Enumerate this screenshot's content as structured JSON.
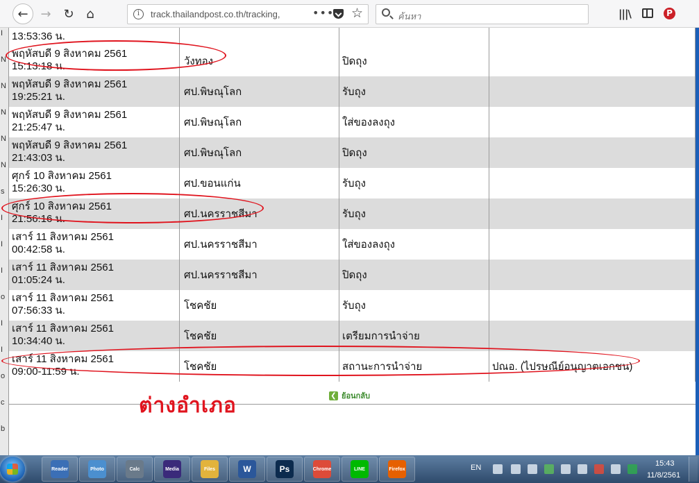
{
  "browser": {
    "url": "track.thailandpost.co.th/tracking,",
    "search_placeholder": "ค้นหา",
    "overflow_dots": "•••"
  },
  "table": {
    "top_cut_time": "13:53:36 น.",
    "rows": [
      {
        "date": "พฤหัสบดี 9 สิงหาคม 2561",
        "time": "15:13:18 น.",
        "location": "วังทอง",
        "status": "ปิดถุง",
        "note": ""
      },
      {
        "date": "พฤหัสบดี 9 สิงหาคม 2561",
        "time": "19:25:21 น.",
        "location": "ศป.พิษณุโลก",
        "status": "รับถุง",
        "note": ""
      },
      {
        "date": "พฤหัสบดี 9 สิงหาคม 2561",
        "time": "21:25:47 น.",
        "location": "ศป.พิษณุโลก",
        "status": "ใส่ของลงถุง",
        "note": ""
      },
      {
        "date": "พฤหัสบดี 9 สิงหาคม 2561",
        "time": "21:43:03 น.",
        "location": "ศป.พิษณุโลก",
        "status": "ปิดถุง",
        "note": ""
      },
      {
        "date": "ศุกร์ 10 สิงหาคม 2561",
        "time": "15:26:30 น.",
        "location": "ศป.ขอนแก่น",
        "status": "รับถุง",
        "note": ""
      },
      {
        "date": "ศุกร์ 10 สิงหาคม 2561",
        "time": "21:56:16 น.",
        "location": "ศป.นครราชสีมา",
        "status": "รับถุง",
        "note": ""
      },
      {
        "date": "เสาร์ 11 สิงหาคม 2561",
        "time": "00:42:58 น.",
        "location": "ศป.นครราชสีมา",
        "status": "ใส่ของลงถุง",
        "note": ""
      },
      {
        "date": "เสาร์ 11 สิงหาคม 2561",
        "time": "01:05:24 น.",
        "location": "ศป.นครราชสีมา",
        "status": "ปิดถุง",
        "note": ""
      },
      {
        "date": "เสาร์ 11 สิงหาคม 2561",
        "time": "07:56:33 น.",
        "location": "โชคชัย",
        "status": "รับถุง",
        "note": ""
      },
      {
        "date": "เสาร์ 11 สิงหาคม 2561",
        "time": "10:34:40 น.",
        "location": "โชคชัย",
        "status": "เตรียมการนำจ่าย",
        "note": ""
      },
      {
        "date": "เสาร์ 11 สิงหาคม 2561",
        "time": "09:00-11:59 น.",
        "location": "โชคชัย",
        "status": "สถานะการนำจ่าย",
        "note": "ปณอ. (ไปรษณีย์อนุญาตเอกชน)"
      }
    ]
  },
  "annotation": {
    "text": "ต่างอำเภอ",
    "color": "#e0141e"
  },
  "back_link": {
    "label": "ย้อนกลับ"
  },
  "left_edge_chars": [
    "I",
    "N",
    "N",
    "N",
    "N",
    "N",
    "s",
    "I",
    "I",
    "I",
    "o",
    "I",
    "I",
    "o",
    "c",
    "b"
  ],
  "taskbar": {
    "lang": "EN",
    "time": "15:43",
    "date": "11/8/2561",
    "apps": [
      {
        "label": "Reader",
        "icon": "reader-icon",
        "color": "#3b6fb6"
      },
      {
        "label": "Photo",
        "icon": "photo-viewer-icon",
        "color": "#4b8fcf"
      },
      {
        "label": "Calc",
        "icon": "calculator-icon",
        "color": "#6a7a8a"
      },
      {
        "label": "Media",
        "icon": "media-player-icon",
        "color": "#3a2a7a"
      },
      {
        "label": "Files",
        "icon": "folder-icon",
        "color": "#e2b33c"
      },
      {
        "label": "W",
        "icon": "word-icon",
        "color": "#2b579a"
      },
      {
        "label": "Ps",
        "icon": "photoshop-icon",
        "color": "#0c2b4e"
      },
      {
        "label": "Chrome",
        "icon": "chrome-icon",
        "color": "#dd4b39"
      },
      {
        "label": "LINE",
        "icon": "line-icon",
        "color": "#00b900"
      },
      {
        "label": "Firefox",
        "icon": "firefox-icon",
        "color": "#e66000"
      }
    ]
  }
}
